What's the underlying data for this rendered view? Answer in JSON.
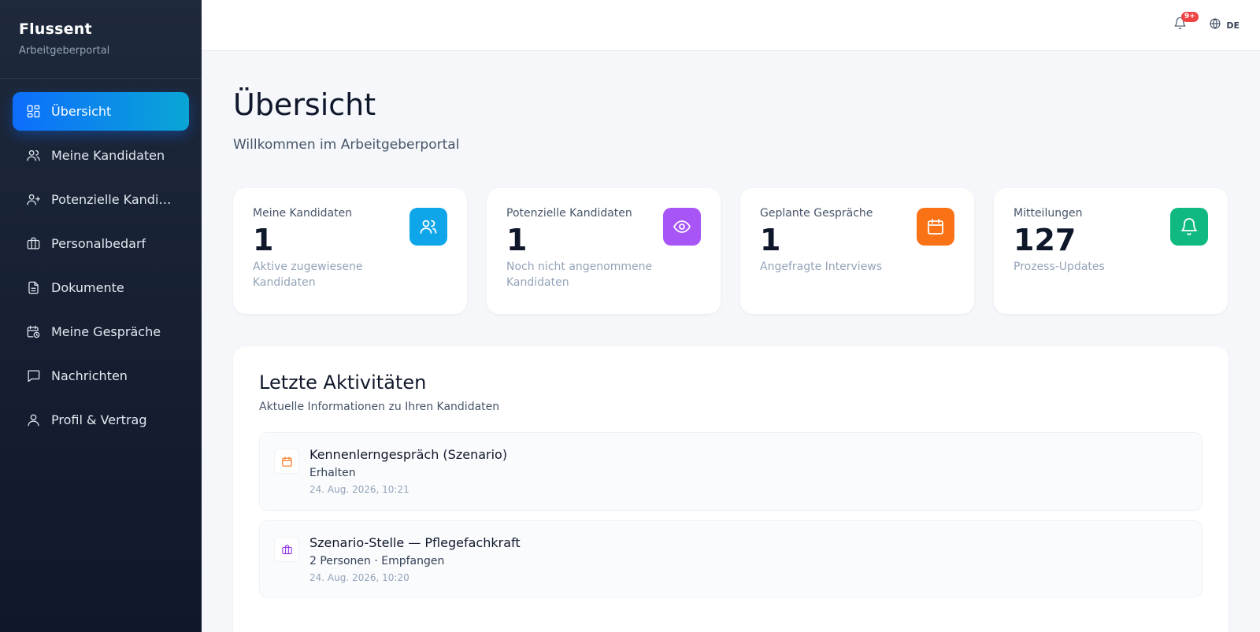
{
  "brand": {
    "name": "Flussent",
    "subtitle": "Arbeitgeberportal"
  },
  "sidebar": {
    "items": [
      {
        "label": "Übersicht",
        "icon": "dashboard-icon",
        "active": true
      },
      {
        "label": "Meine Kandidaten",
        "icon": "users-icon"
      },
      {
        "label": "Potenzielle Kandid...",
        "icon": "user-plus-icon"
      },
      {
        "label": "Personalbedarf",
        "icon": "briefcase-icon"
      },
      {
        "label": "Dokumente",
        "icon": "document-icon"
      },
      {
        "label": "Meine Gespräche",
        "icon": "calendar-clock-icon"
      },
      {
        "label": "Nachrichten",
        "icon": "message-icon"
      },
      {
        "label": "Profil & Vertrag",
        "icon": "user-icon"
      }
    ]
  },
  "topbar": {
    "notification_badge": "9+",
    "language": "DE"
  },
  "page": {
    "title": "Übersicht",
    "subtitle": "Willkommen im Arbeitgeberportal"
  },
  "stats": [
    {
      "label": "Meine Kandidaten",
      "value": "1",
      "desc": "Aktive zugewiesene Kandidaten",
      "icon": "users-icon",
      "color": "#0ea5e9"
    },
    {
      "label": "Potenzielle Kandidaten",
      "value": "1",
      "desc": "Noch nicht angenommene Kandidaten",
      "icon": "eye-icon",
      "color": "#a855f7"
    },
    {
      "label": "Geplante Gespräche",
      "value": "1",
      "desc": "Angefragte Interviews",
      "icon": "calendar-icon",
      "color": "#f97316"
    },
    {
      "label": "Mitteilungen",
      "value": "127",
      "desc": "Prozess-Updates",
      "icon": "bell-icon",
      "color": "#10b981"
    }
  ],
  "activity": {
    "title": "Letzte Aktivitäten",
    "subtitle": "Aktuelle Informationen zu Ihren Kandidaten",
    "items": [
      {
        "name": "Kennenlerngespräch (Szenario)",
        "status": "Erhalten",
        "time": "24. Aug. 2026, 10:21",
        "icon": "calendar-icon",
        "color": "#f97316"
      },
      {
        "name": "Szenario-Stelle — Pflegefachkraft",
        "status": "2 Personen · Empfangen",
        "time": "24. Aug. 2026, 10:20",
        "icon": "briefcase-icon",
        "color": "#9333ea"
      }
    ]
  }
}
